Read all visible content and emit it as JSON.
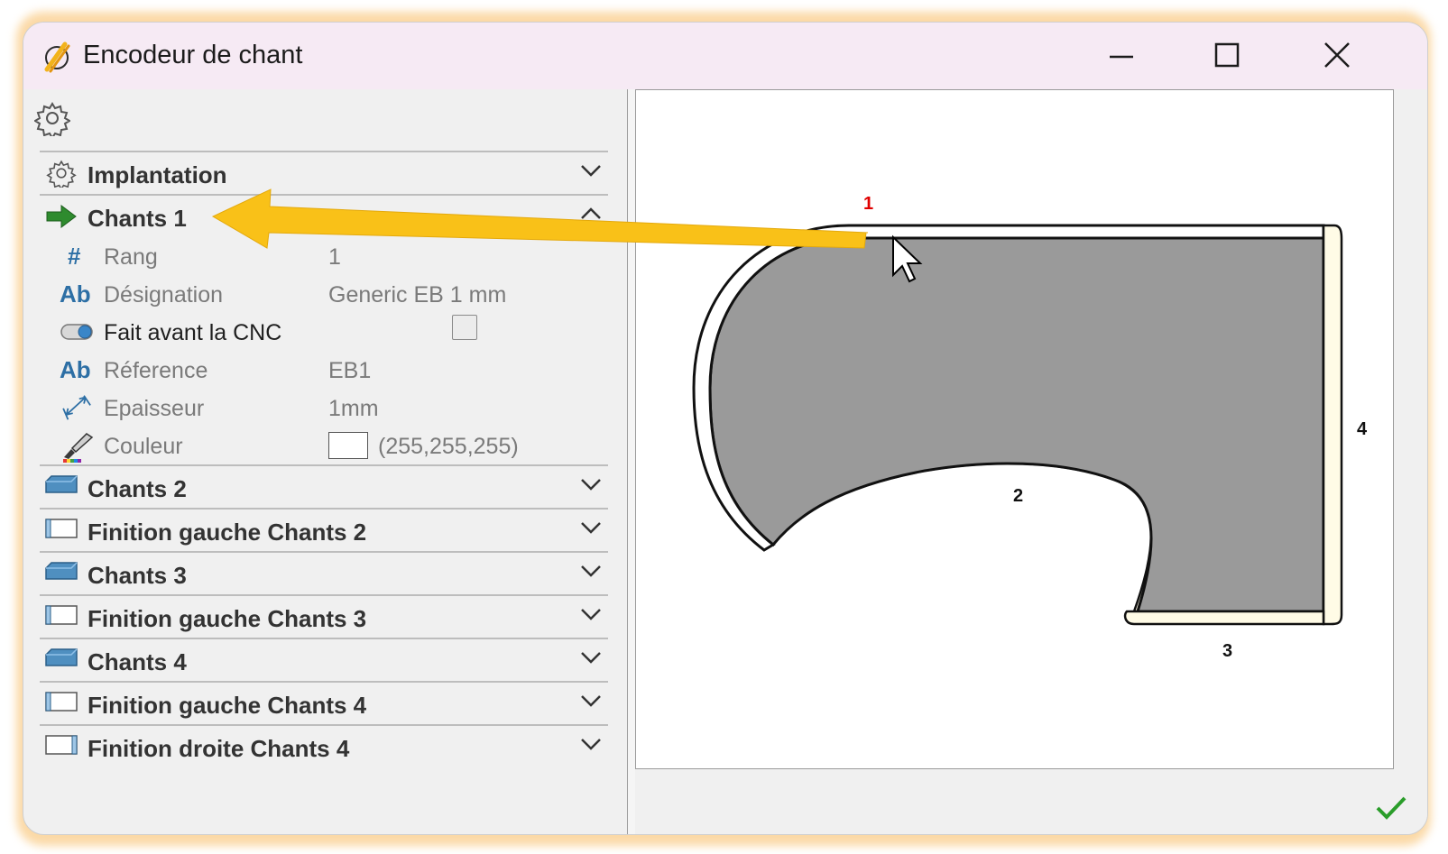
{
  "window": {
    "title": "Encodeur de chant"
  },
  "icons": {
    "app": "pencil-logo-icon",
    "minimize": "minimize-icon",
    "maximize": "maximize-icon",
    "close": "close-icon",
    "settings": "gear-icon",
    "ok": "checkmark-icon"
  },
  "sections": [
    {
      "label": "Implantation",
      "icon": "gear-icon",
      "expanded": false
    },
    {
      "label": "Chants  1",
      "icon": "green-arrow-icon",
      "expanded": true
    },
    {
      "label": "Chants  2",
      "icon": "edge-band-icon",
      "expanded": false
    },
    {
      "label": "Finition gauche Chants 2",
      "icon": "edge-finish-left-icon",
      "expanded": false
    },
    {
      "label": "Chants  3",
      "icon": "edge-band-icon",
      "expanded": false
    },
    {
      "label": "Finition gauche Chants 3",
      "icon": "edge-finish-left-icon",
      "expanded": false
    },
    {
      "label": "Chants  4",
      "icon": "edge-band-icon",
      "expanded": false
    },
    {
      "label": "Finition gauche Chants 4",
      "icon": "edge-finish-left-icon",
      "expanded": false
    },
    {
      "label": "Finition droite Chants 4",
      "icon": "edge-finish-right-icon",
      "expanded": false
    }
  ],
  "properties": {
    "rang": {
      "label": "Rang",
      "value": "1",
      "icon": "hash-icon"
    },
    "designation": {
      "label": "Désignation",
      "value": "Generic EB 1 mm",
      "icon": "text-ab-icon"
    },
    "fait_avant_cnc": {
      "label": "Fait avant la CNC",
      "checked": false,
      "icon": "toggle-icon"
    },
    "reference": {
      "label": "Réference",
      "value": "EB1",
      "icon": "text-ab-icon"
    },
    "epaisseur": {
      "label": "Epaisseur",
      "value": "1mm",
      "icon": "thickness-icon"
    },
    "couleur": {
      "label": "Couleur",
      "value": "(255,255,255)",
      "swatch": "#ffffff",
      "icon": "paintbrush-icon"
    }
  },
  "icon_glyphs": {
    "hash": "#",
    "text_ab": "Ab"
  },
  "drawing": {
    "edge_labels": [
      "1",
      "2",
      "3",
      "4"
    ],
    "active_edge_color": "#e00000",
    "panel_fill": "#9a9a9a",
    "edge_band_fill": "#fffbe6",
    "selected_band_fill": "#ffffff"
  },
  "colors": {
    "title_bar": "#f6eaf4",
    "glow": "#fbd9a6",
    "annotation_arrow": "#f9c118",
    "ok_check": "#2a9d2a"
  }
}
